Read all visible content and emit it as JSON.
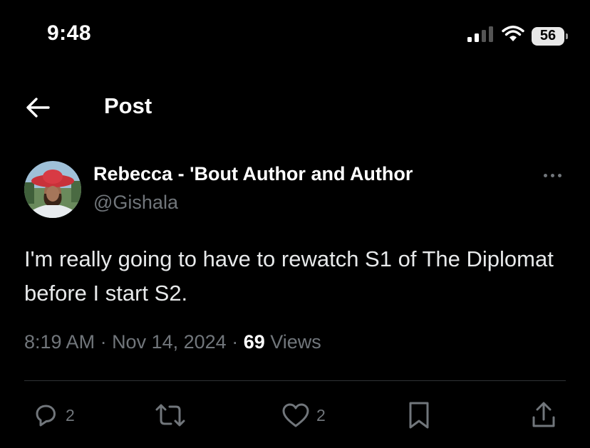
{
  "status_bar": {
    "time": "9:48",
    "battery": "56",
    "icons": [
      "signal-icon",
      "wifi-icon",
      "battery-icon"
    ]
  },
  "header": {
    "title": "Post",
    "back_icon": "arrow-left-icon"
  },
  "post": {
    "display_name": "Rebecca - 'Bout Author and Author",
    "handle": "@Gishala",
    "text": "I'm really going to have to rewatch S1 of The Diplomat before I start S2.",
    "time": "8:19 AM",
    "separator": " · ",
    "date": "Nov 14, 2024",
    "views_count": "69",
    "views_label": "Views"
  },
  "actions": {
    "replies": "2",
    "likes": "2",
    "icons": [
      "reply-icon",
      "repost-icon",
      "like-icon",
      "bookmark-icon",
      "share-icon"
    ]
  },
  "colors": {
    "background": "#000000",
    "text_primary": "#e7e9ea",
    "text_secondary": "#71767b",
    "divider": "#2f3336"
  }
}
